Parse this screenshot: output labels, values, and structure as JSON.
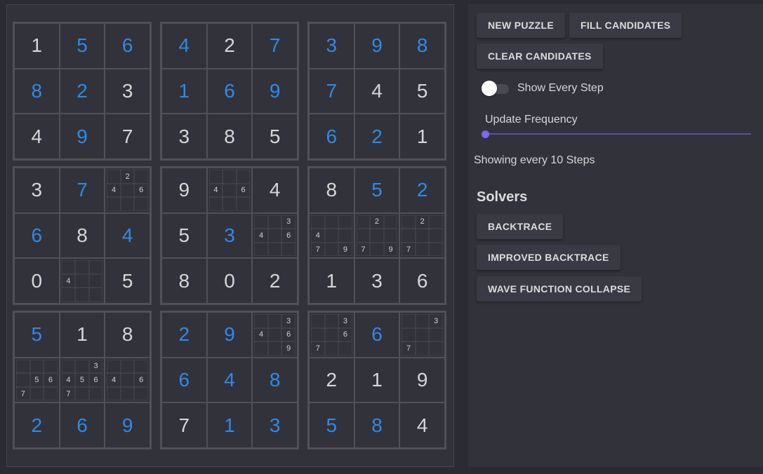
{
  "controls": {
    "new_puzzle_label": "NEW PUZZLE",
    "fill_candidates_label": "FILL CANDIDATES",
    "clear_candidates_label": "CLEAR CANDIDATES",
    "show_every_step_label": "Show Every Step",
    "show_every_step_on": false,
    "update_frequency_label": "Update Frequency",
    "update_frequency_level": 0.0,
    "showing_text": "Showing every 10 Steps"
  },
  "solvers": {
    "heading": "Solvers",
    "buttons": [
      "BACKTRACE",
      "IMPROVED BACKTRACE",
      "WAVE FUNCTION COLLAPSE"
    ]
  },
  "colors": {
    "clue": "#d6d6d6",
    "solved": "#2d8ae6",
    "accent": "#7b68ee"
  },
  "board": [
    [
      {
        "v": "1",
        "t": "clue"
      },
      {
        "v": "5",
        "t": "solved"
      },
      {
        "v": "6",
        "t": "solved"
      },
      {
        "v": "4",
        "t": "solved"
      },
      {
        "v": "2",
        "t": "clue"
      },
      {
        "v": "7",
        "t": "solved"
      },
      {
        "v": "3",
        "t": "solved"
      },
      {
        "v": "9",
        "t": "solved"
      },
      {
        "v": "8",
        "t": "solved"
      }
    ],
    [
      {
        "v": "8",
        "t": "solved"
      },
      {
        "v": "2",
        "t": "solved"
      },
      {
        "v": "3",
        "t": "clue"
      },
      {
        "v": "1",
        "t": "solved"
      },
      {
        "v": "6",
        "t": "solved"
      },
      {
        "v": "9",
        "t": "solved"
      },
      {
        "v": "7",
        "t": "solved"
      },
      {
        "v": "4",
        "t": "clue"
      },
      {
        "v": "5",
        "t": "clue"
      }
    ],
    [
      {
        "v": "4",
        "t": "clue"
      },
      {
        "v": "9",
        "t": "solved"
      },
      {
        "v": "7",
        "t": "clue"
      },
      {
        "v": "3",
        "t": "clue"
      },
      {
        "v": "8",
        "t": "clue"
      },
      {
        "v": "5",
        "t": "clue"
      },
      {
        "v": "6",
        "t": "solved"
      },
      {
        "v": "2",
        "t": "solved"
      },
      {
        "v": "1",
        "t": "clue"
      }
    ],
    [
      {
        "v": "3",
        "t": "clue"
      },
      {
        "v": "7",
        "t": "solved"
      },
      {
        "c": [
          "2",
          "4",
          "6"
        ]
      },
      {
        "v": "9",
        "t": "clue"
      },
      {
        "c": [
          "4",
          "6"
        ]
      },
      {
        "v": "4",
        "t": "clue"
      },
      {
        "v": "8",
        "t": "clue"
      },
      {
        "v": "5",
        "t": "solved"
      },
      {
        "v": "2",
        "t": "solved"
      }
    ],
    [
      {
        "v": "6",
        "t": "solved"
      },
      {
        "v": "8",
        "t": "clue"
      },
      {
        "v": "4",
        "t": "solved"
      },
      {
        "v": "5",
        "t": "clue"
      },
      {
        "v": "3",
        "t": "solved"
      },
      {
        "c": [
          "3",
          "4",
          "6"
        ]
      },
      {
        "c": [
          "4",
          "7",
          "9"
        ]
      },
      {
        "c": [
          "2",
          "7",
          "9"
        ]
      },
      {
        "c": [
          "2",
          "7"
        ]
      }
    ],
    [
      {
        "v": "0",
        "t": "clue"
      },
      {
        "c": [
          "4"
        ]
      },
      {
        "v": "5",
        "t": "clue"
      },
      {
        "v": "8",
        "t": "clue"
      },
      {
        "v": "0",
        "t": "clue"
      },
      {
        "v": "2",
        "t": "clue"
      },
      {
        "v": "1",
        "t": "clue"
      },
      {
        "v": "3",
        "t": "clue"
      },
      {
        "v": "6",
        "t": "clue"
      }
    ],
    [
      {
        "v": "5",
        "t": "solved"
      },
      {
        "v": "1",
        "t": "clue"
      },
      {
        "v": "8",
        "t": "clue"
      },
      {
        "v": "2",
        "t": "solved"
      },
      {
        "v": "9",
        "t": "solved"
      },
      {
        "c": [
          "3",
          "4",
          "6",
          "9"
        ]
      },
      {
        "c": [
          "3",
          "6",
          "7"
        ]
      },
      {
        "v": "6",
        "t": "solved"
      },
      {
        "c": [
          "3",
          "7"
        ]
      }
    ],
    [
      {
        "c": [
          "5",
          "6",
          "7"
        ]
      },
      {
        "c": [
          "3",
          "4",
          "5",
          "6",
          "7"
        ]
      },
      {
        "c": [
          "4",
          "6"
        ]
      },
      {
        "v": "6",
        "t": "solved"
      },
      {
        "v": "4",
        "t": "solved"
      },
      {
        "v": "8",
        "t": "solved"
      },
      {
        "v": "2",
        "t": "clue"
      },
      {
        "v": "1",
        "t": "clue"
      },
      {
        "v": "9",
        "t": "clue"
      }
    ],
    [
      {
        "v": "2",
        "t": "solved"
      },
      {
        "v": "6",
        "t": "solved"
      },
      {
        "v": "9",
        "t": "solved"
      },
      {
        "v": "7",
        "t": "clue"
      },
      {
        "v": "1",
        "t": "solved"
      },
      {
        "v": "3",
        "t": "solved"
      },
      {
        "v": "5",
        "t": "solved"
      },
      {
        "v": "8",
        "t": "solved"
      },
      {
        "v": "4",
        "t": "clue"
      }
    ]
  ]
}
